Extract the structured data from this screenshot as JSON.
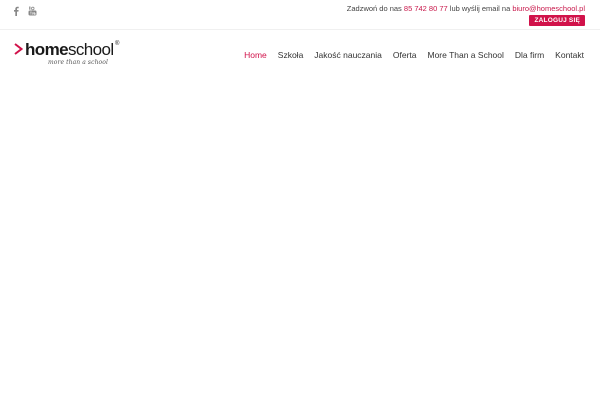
{
  "topbar": {
    "social": [
      {
        "icon": "facebook-icon"
      },
      {
        "icon": "youtube-icon"
      }
    ],
    "contact": {
      "call_prefix": "Zadzwoń do nas",
      "phone": "85 742 80 77",
      "or_email": "lub wyślij email na",
      "email": "biuro@homeschool.pl"
    },
    "login_label": "ZALOGUJ SIĘ"
  },
  "logo": {
    "brand_bold": "home",
    "brand_light": "school",
    "registered": "®",
    "tagline": "more than a school"
  },
  "nav": {
    "items": [
      {
        "label": "Home",
        "active": true
      },
      {
        "label": "Szkoła",
        "active": false
      },
      {
        "label": "Jakość nauczania",
        "active": false
      },
      {
        "label": "Oferta",
        "active": false
      },
      {
        "label": "More Than a School",
        "active": false
      },
      {
        "label": "Dla firm",
        "active": false
      },
      {
        "label": "Kontakt",
        "active": false
      }
    ]
  },
  "colors": {
    "accent": "#d1124a",
    "text": "#333333",
    "icon": "#888888"
  }
}
